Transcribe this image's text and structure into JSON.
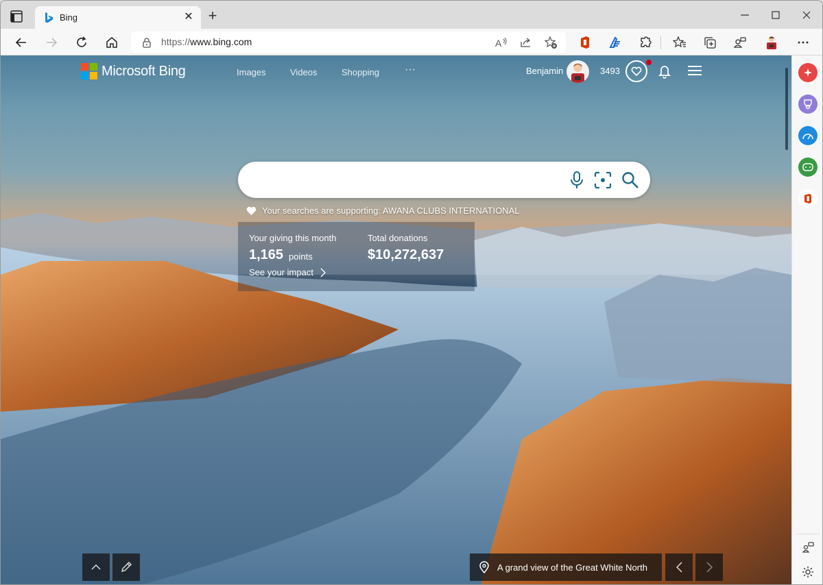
{
  "browser": {
    "tab_title": "Bing",
    "url_protocol": "https://",
    "url_host": "www.bing.com",
    "window_controls": [
      "minimize",
      "maximize",
      "close"
    ]
  },
  "toolbar": {
    "icons": [
      "read-aloud-icon",
      "share-icon",
      "add-favorite-icon",
      "office-icon",
      "designer-icon",
      "extensions-icon",
      "favorites-icon",
      "collections-icon",
      "profile-switch-icon",
      "profile-avatar",
      "more-icon"
    ]
  },
  "bing": {
    "logo_text": "Microsoft Bing",
    "nav": [
      "Images",
      "Videos",
      "Shopping"
    ],
    "more_label": "···",
    "user_name": "Benjamin",
    "reward_points": "3493",
    "search_placeholder": "",
    "supporting_text": "Your searches are supporting: AWANA CLUBS INTERNATIONAL",
    "giving_label": "Your giving this month",
    "giving_value": "1,165",
    "giving_unit": "points",
    "donations_label": "Total donations",
    "donations_value": "$10,272,637",
    "impact_link": "See your impact",
    "image_caption": "A grand view of the Great White North"
  },
  "sidebar": {
    "items": [
      {
        "name": "discover",
        "color": "#e84545"
      },
      {
        "name": "rewards",
        "color": "#8e7cd6"
      },
      {
        "name": "tools",
        "color": "#1f8be0"
      },
      {
        "name": "games",
        "color": "#3a9b45"
      },
      {
        "name": "office",
        "color": "#ffffff"
      }
    ]
  },
  "colors": {
    "ms_red": "#f25022",
    "ms_green": "#7fba00",
    "ms_blue": "#00a4ef",
    "ms_yellow": "#ffb900",
    "search_icon_color": "#1a6a88"
  }
}
